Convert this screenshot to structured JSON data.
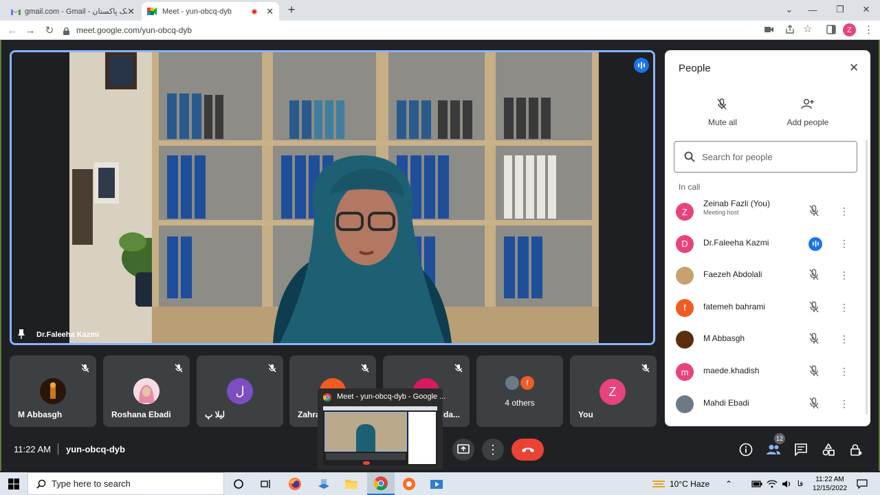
{
  "tabs": [
    {
      "title": "gmail.com - Gmail - لینک پاکستان",
      "icon": "gmail-icon"
    },
    {
      "title": "Meet - yun-obcq-dyb",
      "icon": "meet-icon"
    }
  ],
  "address": {
    "url": "meet.google.com/yun-obcq-dyb"
  },
  "main_video": {
    "speaker": "Dr.Faleeha Kazmi"
  },
  "tiles": [
    {
      "name": "M Abbasgh"
    },
    {
      "name": "Roshana Ebadi"
    },
    {
      "name": "لیلا پ",
      "initial": "ل"
    },
    {
      "name": "Zahra"
    },
    {
      "name": "lda..."
    },
    {
      "name": "4 others"
    },
    {
      "name": "You",
      "initial": "Z"
    }
  ],
  "others_badge": "f",
  "pip": {
    "title": "Meet - yun-obcq-dyb - Google ..."
  },
  "people_panel": {
    "title": "People",
    "mute_all": "Mute all",
    "add_people": "Add people",
    "search_placeholder": "Search for people",
    "section": "In call",
    "rows": [
      {
        "name": "Zeinab Fazli (You)",
        "sub": "Meeting host",
        "initial": "Z",
        "color": "#e8437e"
      },
      {
        "name": "Dr.Faleeha Kazmi",
        "sub": "",
        "initial": "D",
        "color": "#e8437e"
      },
      {
        "name": "Faezeh Abdolali",
        "sub": "",
        "initial": "",
        "color": "#c9a16e"
      },
      {
        "name": "fatemeh bahrami",
        "sub": "",
        "initial": "f",
        "color": "#f25b24"
      },
      {
        "name": "M Abbasgh",
        "sub": "",
        "initial": "",
        "color": "#5a2e0e"
      },
      {
        "name": "maede.khadish",
        "sub": "",
        "initial": "m",
        "color": "#e8437e"
      },
      {
        "name": "Mahdi Ebadi",
        "sub": "",
        "initial": "",
        "color": "#6d7a86"
      }
    ]
  },
  "meeting": {
    "time": "11:22 AM",
    "code": "yun-obcq-dyb",
    "participants_badge": "12"
  },
  "taskbar": {
    "search_placeholder": "Type here to search",
    "weather": "10°C  Haze",
    "lang": "فا",
    "time": "11:22 AM",
    "date": "12/15/2022"
  },
  "colors": {
    "accent": "#8ab4f8",
    "end_call": "#ea4335",
    "speaking": "#1a73e8"
  }
}
